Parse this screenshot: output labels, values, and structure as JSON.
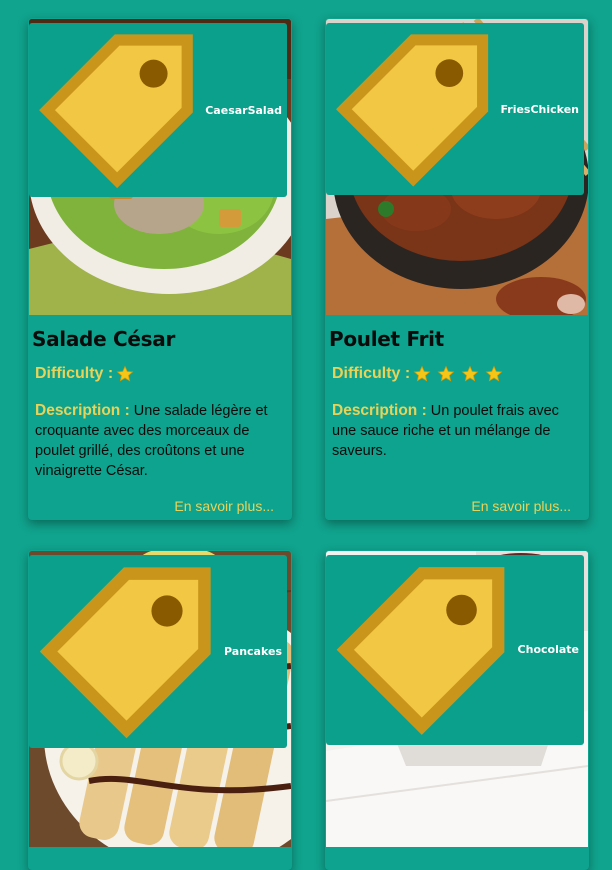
{
  "cards": [
    {
      "tag": "CaesarSalad",
      "title": "Salade César",
      "difficulty_label": "Difficulty :",
      "difficulty": 1,
      "description_label": "Description :",
      "description": "Une salade légère et croquante avec des morceaux de poulet grillé, des croûtons et une vinaigrette César.",
      "more": "En savoir plus..."
    },
    {
      "tag": "FriesChicken",
      "title": "Poulet Frit",
      "difficulty_label": "Difficulty :",
      "difficulty": 4,
      "description_label": "Description :",
      "description": "Un poulet frais avec une sauce riche et un mélange de saveurs.",
      "more": "En savoir plus..."
    },
    {
      "tag": "Pancakes"
    },
    {
      "tag": "Chocolate"
    }
  ],
  "colors": {
    "background": "#10a38d",
    "accent_text": "#e8d35a",
    "star": "#f5c518"
  }
}
